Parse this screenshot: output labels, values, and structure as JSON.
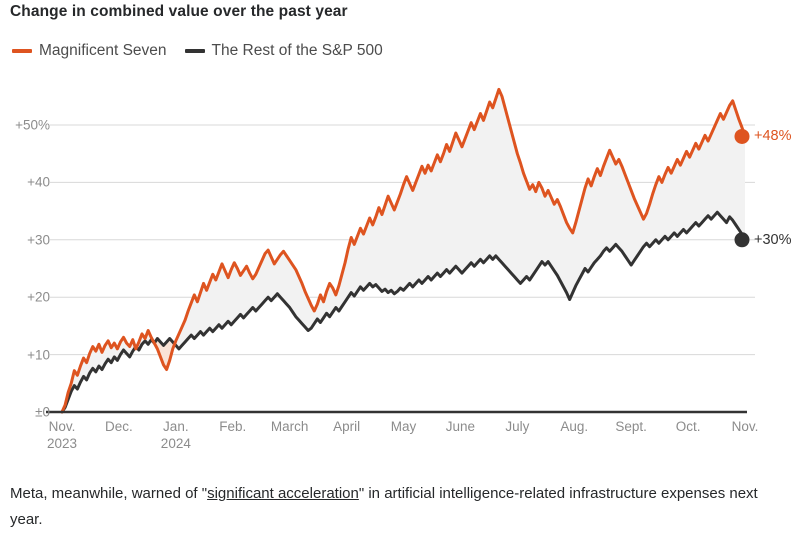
{
  "header": {
    "title": "Change in combined value over the past year"
  },
  "legend": [
    {
      "label": "Magnificent Seven",
      "color": "#DE5420"
    },
    {
      "label": "The Rest of the S&P 500",
      "color": "#333333"
    }
  ],
  "caption": {
    "text_before": "Meta, meanwhile, warned of \"",
    "link_text": "significant acceleration",
    "text_after": "\" in artificial intelligence-related infrastructure expenses next year."
  },
  "end_labels": [
    {
      "name": "magnificent-seven-end-value",
      "text": "+48%",
      "value": 48,
      "color": "#DE5420"
    },
    {
      "name": "rest-of-sp500-end-value",
      "text": "+30%",
      "value": 30,
      "color": "#333333"
    }
  ],
  "colors": {
    "accent_orange": "#DE5420",
    "dark_line": "#333333",
    "gridline": "#d8d8d8",
    "axis": "#333333",
    "fill_gray": "#f2f2f2",
    "fill_orange": "#fae3d6",
    "tick_text": "#8c8c8c",
    "title_text": "#26282a"
  },
  "chart_data": {
    "type": "line",
    "title": "Change in combined value over the past year",
    "subtitle": "",
    "xlabel": "",
    "ylabel": "",
    "ylim": [
      0,
      57
    ],
    "yticks": [
      0,
      10,
      20,
      30,
      40,
      50
    ],
    "ytick_labels": [
      "±0",
      "+10",
      "+20",
      "+30",
      "+40",
      "+50%"
    ],
    "grid": true,
    "legend_position": "top-left",
    "x_tick_labels": [
      {
        "label": "Nov.",
        "sublabel": "2023",
        "month_index": 0
      },
      {
        "label": "Dec.",
        "sublabel": "",
        "month_index": 1
      },
      {
        "label": "Jan.",
        "sublabel": "2024",
        "month_index": 2
      },
      {
        "label": "Feb.",
        "sublabel": "",
        "month_index": 3
      },
      {
        "label": "March",
        "sublabel": "",
        "month_index": 4
      },
      {
        "label": "April",
        "sublabel": "",
        "month_index": 5
      },
      {
        "label": "May",
        "sublabel": "",
        "month_index": 6
      },
      {
        "label": "June",
        "sublabel": "",
        "month_index": 7
      },
      {
        "label": "July",
        "sublabel": "",
        "month_index": 8
      },
      {
        "label": "Aug.",
        "sublabel": "",
        "month_index": 9
      },
      {
        "label": "Sept.",
        "sublabel": "",
        "month_index": 10
      },
      {
        "label": "Oct.",
        "sublabel": "",
        "month_index": 11
      },
      {
        "label": "Nov.",
        "sublabel": "",
        "month_index": 12
      }
    ],
    "x_range": [
      0,
      12
    ],
    "series": [
      {
        "name": "Magnificent Seven",
        "color": "#DE5420",
        "end_value": 48,
        "values": [
          0.0,
          1.2,
          3.4,
          5.0,
          7.2,
          6.4,
          8.0,
          9.4,
          8.6,
          10.2,
          11.4,
          10.6,
          11.8,
          10.4,
          11.6,
          12.4,
          11.2,
          12.0,
          11.0,
          12.2,
          13.0,
          12.0,
          11.4,
          12.6,
          11.0,
          12.2,
          13.6,
          12.8,
          14.2,
          13.0,
          12.0,
          11.0,
          9.6,
          8.2,
          7.4,
          9.0,
          11.0,
          12.4,
          13.6,
          14.8,
          16.0,
          17.6,
          19.0,
          20.4,
          19.2,
          20.8,
          22.4,
          21.2,
          22.6,
          24.0,
          23.0,
          24.4,
          25.8,
          24.6,
          23.4,
          24.8,
          26.0,
          25.0,
          23.8,
          24.6,
          25.4,
          24.2,
          23.2,
          24.0,
          25.2,
          26.4,
          27.6,
          28.2,
          27.0,
          25.8,
          26.6,
          27.4,
          28.0,
          27.2,
          26.4,
          25.6,
          24.8,
          23.6,
          22.4,
          21.0,
          19.8,
          18.6,
          17.6,
          18.8,
          20.4,
          19.2,
          21.0,
          22.4,
          21.6,
          20.4,
          22.0,
          24.0,
          26.0,
          28.4,
          30.4,
          29.2,
          30.6,
          32.0,
          31.0,
          32.4,
          33.8,
          32.6,
          34.0,
          35.6,
          34.4,
          36.0,
          37.6,
          36.4,
          35.2,
          36.6,
          38.0,
          39.6,
          41.0,
          39.8,
          38.6,
          40.0,
          41.4,
          42.8,
          41.6,
          43.0,
          42.0,
          43.4,
          44.8,
          43.6,
          45.0,
          46.6,
          45.4,
          47.0,
          48.6,
          47.4,
          46.2,
          47.6,
          49.0,
          50.4,
          49.2,
          50.6,
          52.0,
          50.8,
          52.4,
          54.0,
          53.0,
          54.6,
          56.2,
          55.0,
          53.0,
          51.0,
          49.0,
          47.0,
          45.0,
          43.4,
          41.6,
          40.2,
          38.8,
          39.6,
          38.4,
          40.0,
          39.0,
          37.6,
          38.6,
          37.4,
          36.2,
          37.0,
          35.8,
          34.4,
          33.0,
          32.0,
          31.2,
          33.0,
          35.0,
          37.0,
          39.0,
          40.6,
          39.4,
          41.0,
          42.4,
          41.2,
          42.8,
          44.2,
          45.6,
          44.4,
          43.2,
          44.0,
          42.8,
          41.4,
          40.0,
          38.6,
          37.2,
          36.0,
          34.8,
          33.6,
          34.6,
          36.2,
          38.0,
          39.6,
          41.0,
          40.0,
          41.4,
          42.6,
          41.6,
          42.8,
          44.0,
          43.0,
          44.2,
          45.4,
          44.4,
          45.6,
          46.8,
          45.8,
          47.0,
          48.2,
          47.2,
          48.4,
          49.6,
          50.8,
          52.0,
          51.0,
          52.2,
          53.4,
          54.2,
          52.6,
          51.0,
          49.6,
          48.0
        ]
      },
      {
        "name": "The Rest of the S&P 500",
        "color": "#333333",
        "end_value": 30,
        "values": [
          0.0,
          0.8,
          2.2,
          3.6,
          4.6,
          4.0,
          5.2,
          6.2,
          5.6,
          6.8,
          7.6,
          7.0,
          8.0,
          7.4,
          8.4,
          9.2,
          8.6,
          9.6,
          9.0,
          10.0,
          10.8,
          10.2,
          9.6,
          10.6,
          11.4,
          10.8,
          11.8,
          12.4,
          11.8,
          12.6,
          12.0,
          12.8,
          12.2,
          11.6,
          12.2,
          12.8,
          12.2,
          11.6,
          11.0,
          11.6,
          12.2,
          12.8,
          13.4,
          12.8,
          13.4,
          14.0,
          13.4,
          14.0,
          14.6,
          14.0,
          14.6,
          15.2,
          14.6,
          15.2,
          15.8,
          15.2,
          15.8,
          16.4,
          17.0,
          16.4,
          17.0,
          17.6,
          18.2,
          17.6,
          18.2,
          18.8,
          19.4,
          20.0,
          19.4,
          20.0,
          20.6,
          20.0,
          19.4,
          18.8,
          18.2,
          17.4,
          16.6,
          16.0,
          15.4,
          14.8,
          14.2,
          14.6,
          15.4,
          16.2,
          15.6,
          16.4,
          17.2,
          16.6,
          17.4,
          18.2,
          17.6,
          18.4,
          19.2,
          20.0,
          20.8,
          20.2,
          21.0,
          21.8,
          21.2,
          21.8,
          22.4,
          21.8,
          22.2,
          21.6,
          21.0,
          21.4,
          20.8,
          21.2,
          20.6,
          21.0,
          21.6,
          21.2,
          21.8,
          22.4,
          21.8,
          22.4,
          23.0,
          22.4,
          23.0,
          23.6,
          23.0,
          23.6,
          24.2,
          23.6,
          24.2,
          24.8,
          24.2,
          24.8,
          25.4,
          24.8,
          24.2,
          24.8,
          25.4,
          26.0,
          25.4,
          26.0,
          26.6,
          26.0,
          26.6,
          27.2,
          26.6,
          27.2,
          26.6,
          26.0,
          25.4,
          24.8,
          24.2,
          23.6,
          23.0,
          22.4,
          23.0,
          23.6,
          23.0,
          23.8,
          24.6,
          25.4,
          26.2,
          25.6,
          26.2,
          25.4,
          24.6,
          23.8,
          22.8,
          21.8,
          20.8,
          19.6,
          20.8,
          22.0,
          23.0,
          24.0,
          25.0,
          24.4,
          25.2,
          26.0,
          26.6,
          27.2,
          28.0,
          28.6,
          28.0,
          28.6,
          29.2,
          28.6,
          28.0,
          27.2,
          26.4,
          25.6,
          26.4,
          27.2,
          28.0,
          28.8,
          29.4,
          28.8,
          29.4,
          30.0,
          29.4,
          30.0,
          30.6,
          30.0,
          30.6,
          31.2,
          30.6,
          31.2,
          31.8,
          31.2,
          31.8,
          32.4,
          33.0,
          32.4,
          33.0,
          33.6,
          34.2,
          33.6,
          34.2,
          34.8,
          34.2,
          33.6,
          33.0,
          34.0,
          33.4,
          32.6,
          31.8,
          31.0,
          30.0
        ]
      }
    ]
  }
}
